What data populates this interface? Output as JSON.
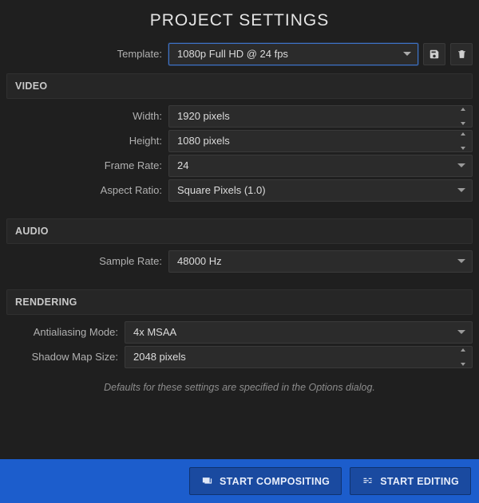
{
  "title": "PROJECT SETTINGS",
  "template": {
    "label": "Template:",
    "value": "1080p Full HD @ 24 fps"
  },
  "sections": {
    "video": {
      "header": "VIDEO",
      "width_label": "Width:",
      "width_value": "1920 pixels",
      "height_label": "Height:",
      "height_value": "1080 pixels",
      "framerate_label": "Frame Rate:",
      "framerate_value": "24",
      "aspect_label": "Aspect Ratio:",
      "aspect_value": "Square Pixels (1.0)"
    },
    "audio": {
      "header": "AUDIO",
      "samplerate_label": "Sample Rate:",
      "samplerate_value": "48000 Hz"
    },
    "rendering": {
      "header": "RENDERING",
      "aa_label": "Antialiasing Mode:",
      "aa_value": "4x MSAA",
      "shadow_label": "Shadow Map Size:",
      "shadow_value": "2048 pixels",
      "note": "Defaults for these settings are specified in the Options dialog."
    }
  },
  "footer": {
    "compositing": "START COMPOSITING",
    "editing": "START EDITING"
  }
}
